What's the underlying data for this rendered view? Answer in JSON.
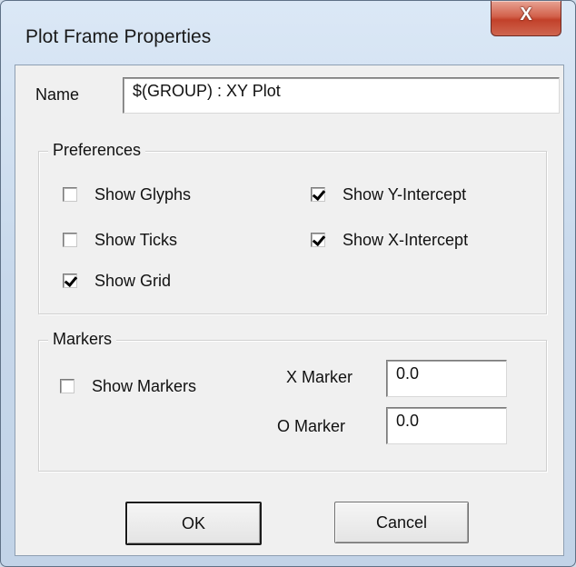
{
  "window": {
    "title": "Plot Frame Properties",
    "close_glyph": "X"
  },
  "name_field": {
    "label": "Name",
    "value": "$(GROUP) : XY Plot"
  },
  "preferences": {
    "title": "Preferences",
    "options": [
      {
        "label": "Show Glyphs",
        "checked": false
      },
      {
        "label": "Show Ticks",
        "checked": false
      },
      {
        "label": "Show Grid",
        "checked": true
      },
      {
        "label": "Show Y-Intercept",
        "checked": true
      },
      {
        "label": "Show X-Intercept",
        "checked": true
      }
    ]
  },
  "markers": {
    "title": "Markers",
    "show_markers": {
      "label": "Show Markers",
      "checked": false
    },
    "x_marker": {
      "label": "X Marker",
      "value": "0.0"
    },
    "o_marker": {
      "label": "O Marker",
      "value": "0.0"
    }
  },
  "buttons": {
    "ok": "OK",
    "cancel": "Cancel"
  }
}
